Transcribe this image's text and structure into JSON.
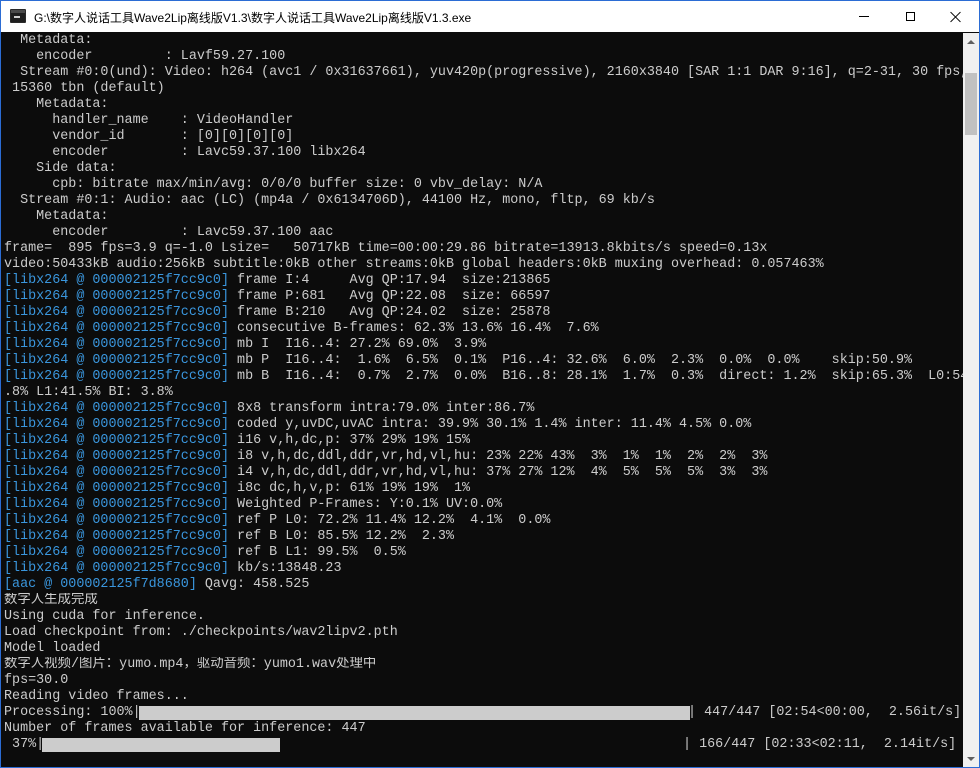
{
  "window": {
    "title": "G:\\数字人说话工具Wave2Lip离线版V1.3\\数字人说话工具Wave2Lip离线版V1.3.exe",
    "icon": "console-app-icon",
    "controls": {
      "minimize": "minimize-icon",
      "maximize": "maximize-icon",
      "close": "close-icon"
    }
  },
  "colors": {
    "console_bg": "#0c0c0c",
    "console_text": "#cccccc",
    "tag_text": "#3a96dd",
    "progress_fill": "#cccccc"
  },
  "console": {
    "lines": [
      {
        "text": "  Metadata:"
      },
      {
        "text": "    encoder         : Lavf59.27.100"
      },
      {
        "text": "  Stream #0:0(und): Video: h264 (avc1 / 0x31637661), yuv420p(progressive), 2160x3840 [SAR 1:1 DAR 9:16], q=2-31, 30 fps,"
      },
      {
        "text": " 15360 tbn (default)"
      },
      {
        "text": "    Metadata:"
      },
      {
        "text": "      handler_name    : VideoHandler"
      },
      {
        "text": "      vendor_id       : [0][0][0][0]"
      },
      {
        "text": "      encoder         : Lavc59.37.100 libx264"
      },
      {
        "text": "    Side data:"
      },
      {
        "text": "      cpb: bitrate max/min/avg: 0/0/0 buffer size: 0 vbv_delay: N/A"
      },
      {
        "text": "  Stream #0:1: Audio: aac (LC) (mp4a / 0x6134706D), 44100 Hz, mono, fltp, 69 kb/s"
      },
      {
        "text": "    Metadata:"
      },
      {
        "text": "      encoder         : Lavc59.37.100 aac"
      },
      {
        "text": "frame=  895 fps=3.9 q=-1.0 Lsize=   50717kB time=00:00:29.86 bitrate=13913.8kbits/s speed=0.13x"
      },
      {
        "text": "video:50433kB audio:256kB subtitle:0kB other streams:0kB global headers:0kB muxing overhead: 0.057463%"
      },
      {
        "tag": "[libx264 @ 000002125f7cc9c0]",
        "text": " frame I:4     Avg QP:17.94  size:213865"
      },
      {
        "tag": "[libx264 @ 000002125f7cc9c0]",
        "text": " frame P:681   Avg QP:22.08  size: 66597"
      },
      {
        "tag": "[libx264 @ 000002125f7cc9c0]",
        "text": " frame B:210   Avg QP:24.02  size: 25878"
      },
      {
        "tag": "[libx264 @ 000002125f7cc9c0]",
        "text": " consecutive B-frames: 62.3% 13.6% 16.4%  7.6%"
      },
      {
        "tag": "[libx264 @ 000002125f7cc9c0]",
        "text": " mb I  I16..4: 27.2% 69.0%  3.9%"
      },
      {
        "tag": "[libx264 @ 000002125f7cc9c0]",
        "text": " mb P  I16..4:  1.6%  6.5%  0.1%  P16..4: 32.6%  6.0%  2.3%  0.0%  0.0%    skip:50.9%"
      },
      {
        "tag": "[libx264 @ 000002125f7cc9c0]",
        "text": " mb B  I16..4:  0.7%  2.7%  0.0%  B16..8: 28.1%  1.7%  0.3%  direct: 1.2%  skip:65.3%  L0:54"
      },
      {
        "text": ".8% L1:41.5% BI: 3.8%"
      },
      {
        "tag": "[libx264 @ 000002125f7cc9c0]",
        "text": " 8x8 transform intra:79.0% inter:86.7%"
      },
      {
        "tag": "[libx264 @ 000002125f7cc9c0]",
        "text": " coded y,uvDC,uvAC intra: 39.9% 30.1% 1.4% inter: 11.4% 4.5% 0.0%"
      },
      {
        "tag": "[libx264 @ 000002125f7cc9c0]",
        "text": " i16 v,h,dc,p: 37% 29% 19% 15%"
      },
      {
        "tag": "[libx264 @ 000002125f7cc9c0]",
        "text": " i8 v,h,dc,ddl,ddr,vr,hd,vl,hu: 23% 22% 43%  3%  1%  1%  2%  2%  3%"
      },
      {
        "tag": "[libx264 @ 000002125f7cc9c0]",
        "text": " i4 v,h,dc,ddl,ddr,vr,hd,vl,hu: 37% 27% 12%  4%  5%  5%  5%  3%  3%"
      },
      {
        "tag": "[libx264 @ 000002125f7cc9c0]",
        "text": " i8c dc,h,v,p: 61% 19% 19%  1%"
      },
      {
        "tag": "[libx264 @ 000002125f7cc9c0]",
        "text": " Weighted P-Frames: Y:0.1% UV:0.0%"
      },
      {
        "tag": "[libx264 @ 000002125f7cc9c0]",
        "text": " ref P L0: 72.2% 11.4% 12.2%  4.1%  0.0%"
      },
      {
        "tag": "[libx264 @ 000002125f7cc9c0]",
        "text": " ref B L0: 85.5% 12.2%  2.3%"
      },
      {
        "tag": "[libx264 @ 000002125f7cc9c0]",
        "text": " ref B L1: 99.5%  0.5%"
      },
      {
        "tag": "[libx264 @ 000002125f7cc9c0]",
        "text": " kb/s:13848.23"
      },
      {
        "tag": "[aac @ 000002125f7d8680]",
        "text": " Qavg: 458.525"
      },
      {
        "text": "数字人生成完成"
      },
      {
        "text": "Using cuda for inference."
      },
      {
        "text": "Load checkpoint from: ./checkpoints/wav2lipv2.pth"
      },
      {
        "text": "Model loaded"
      },
      {
        "text": "数字人视频/图片：yumo.mp4，驱动音频：yumo1.wav处理中"
      },
      {
        "text": "fps=30.0"
      },
      {
        "text": "Reading video frames..."
      }
    ],
    "progress": [
      {
        "prefix": "Processing: 100%|",
        "suffix": "| 447/447 [02:54<00:00,  2.56it/s]",
        "fraction": 1.0
      },
      {
        "text": "Number of frames available for inference: 447"
      },
      {
        "prefix": " 37%|",
        "suffix": "| 166/447 [02:33<02:11,  2.14it/s]",
        "fraction": 0.37
      }
    ]
  }
}
